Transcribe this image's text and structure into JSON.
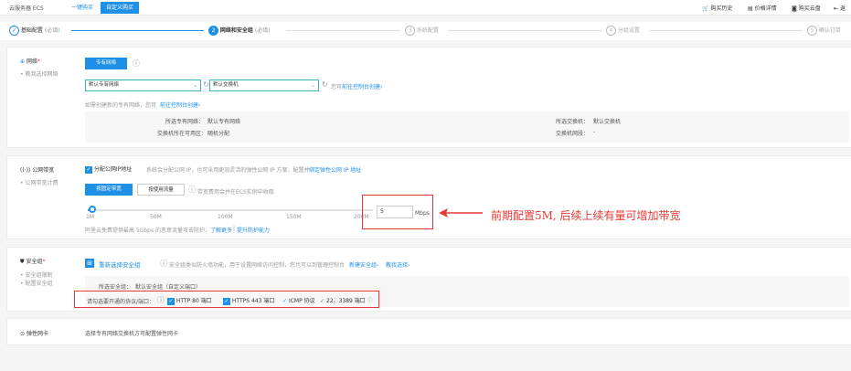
{
  "topbar": {
    "brand": "云服务器 ECS",
    "tabs": [
      "一键购买",
      "自定义购买"
    ],
    "right_links": [
      "购买历史",
      "价格详情",
      "购买云盘",
      "返"
    ]
  },
  "steps": [
    {
      "label": "基础配置",
      "note": "(必填)",
      "num": "✓"
    },
    {
      "label": "网络和安全组",
      "note": "(必填)",
      "num": "2"
    },
    {
      "label": "系统配置",
      "note": "",
      "num": "3"
    },
    {
      "label": "分组设置",
      "note": "",
      "num": "4"
    },
    {
      "label": "确认订单",
      "note": "",
      "num": "5"
    }
  ],
  "network": {
    "title": "网络",
    "required": "*",
    "help": "教我选择网络",
    "type_button": "专有网络",
    "vpc_select": "默认专有网络",
    "vswitch_select": "默认交换机",
    "vswitch_hint": "您可",
    "vswitch_link": "前往控制台创建›",
    "create_hint": "如需创建新的专有网络，您可",
    "create_link": "前往控制台创建›",
    "info": {
      "vpc_label": "所选专有网络：",
      "vpc_value": "默认专有网络",
      "zone_label": "交换机所在可用区：",
      "zone_value": "随机分配",
      "vswitch_label": "所选交换机：",
      "vswitch_value": "默认交换机",
      "cidr_label": "交换机网段：",
      "cidr_value": "-"
    }
  },
  "bandwidth": {
    "title": "公网带宽",
    "help": "公网带宽计费",
    "assign_ip_label": "分配公网IP地址",
    "assign_ip_desc": "系统会分配公网 IP，也可采用更加灵活的弹性公网 IP 方案，配置并",
    "assign_ip_link": "绑定弹性公网 IP 地址",
    "btn_fixed": "按固定带宽",
    "btn_traffic": "按使用流量",
    "billing_note": "带宽费用会并在ECS实例中收取",
    "slider_ticks": [
      "1M",
      "50M",
      "100M",
      "150M",
      "200M"
    ],
    "value": "5",
    "unit": "Mbps",
    "ddos_note": "阿里云免费提供最高 5Gbps 的恶意流量攻击防护，",
    "ddos_link1": "了解更多",
    "ddos_sep": "|",
    "ddos_link2": "提升防护能力"
  },
  "annotation": "前期配置5M, 后续上续有量可增加带宽",
  "security": {
    "title": "安全组",
    "required": "*",
    "help1": "安全组限制",
    "help2": "配置安全组",
    "reselect": "重新选择安全组",
    "desc": "安全组类似防火墙功能，用于设置网络访问控制，您也可以到管理控制台",
    "desc_link1": "新建安全组›",
    "desc_link2": "教我选择›",
    "selected_label": "所选安全组：",
    "selected_value": "默认安全组（自定义端口）",
    "ports_label": "请勾选要开通的协议/端口：",
    "ports": [
      "HTTP 80 端口",
      "HTTPS 443 端口",
      "ICMP 协议",
      "22、3389 端口"
    ]
  },
  "eni": {
    "title": "弹性网卡",
    "desc": "选择专有网络交换机方可配置弹性网卡"
  }
}
